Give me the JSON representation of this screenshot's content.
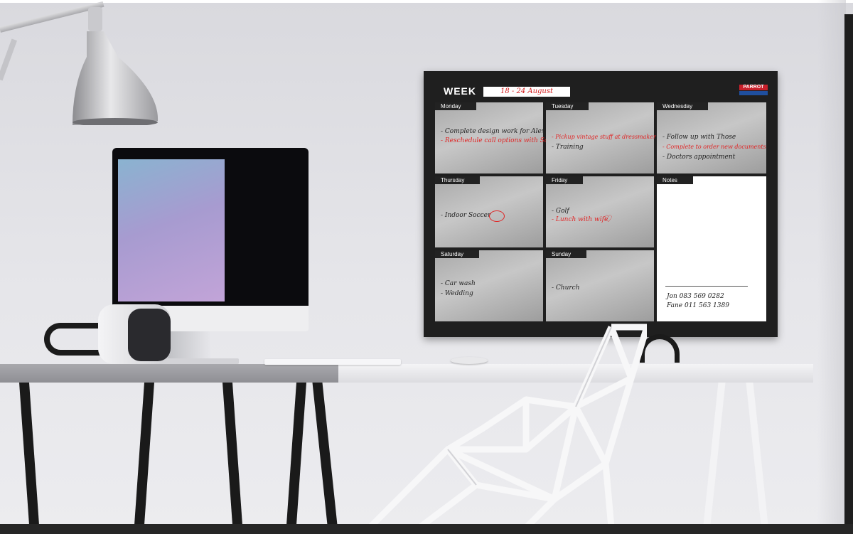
{
  "planner": {
    "week_label": "WEEK",
    "date_range": "18 - 24 August",
    "brand": "PARROT",
    "days": [
      {
        "key": "monday",
        "label": "Monday",
        "tasks": [
          {
            "text": "- Complete design work for Alex",
            "color": "black"
          },
          {
            "text": "- Reschedule call options with Sara",
            "color": "red"
          }
        ]
      },
      {
        "key": "tuesday",
        "label": "Tuesday",
        "tasks": [
          {
            "text": "- Pickup vintage stuff at dressmaker",
            "color": "red"
          },
          {
            "text": "- Training",
            "color": "black"
          }
        ]
      },
      {
        "key": "wednesday",
        "label": "Wednesday",
        "tasks": [
          {
            "text": "- Follow up with Those",
            "color": "black"
          },
          {
            "text": "- Complete to order new documents",
            "color": "red"
          },
          {
            "text": "- Doctors appointment",
            "color": "black"
          }
        ]
      },
      {
        "key": "thursday",
        "label": "Thursday",
        "tasks": [
          {
            "text": "- Indoor Soccer",
            "color": "black"
          }
        ]
      },
      {
        "key": "friday",
        "label": "Friday",
        "tasks": [
          {
            "text": "- Golf",
            "color": "black"
          },
          {
            "text": "- Lunch with wife",
            "color": "red"
          }
        ]
      },
      {
        "key": "saturday",
        "label": "Saturday",
        "tasks": [
          {
            "text": "- Car wash",
            "color": "black"
          },
          {
            "text": "- Wedding",
            "color": "black"
          }
        ]
      },
      {
        "key": "sunday",
        "label": "Sunday",
        "tasks": [
          {
            "text": "- Church",
            "color": "black"
          }
        ]
      }
    ],
    "notes": {
      "label": "Notes",
      "lines": [
        "Jon 083 569 0282",
        "Fane 011 563 1389"
      ]
    }
  },
  "colors": {
    "board": "#1f1f1f",
    "red_marker": "#e02424",
    "wall": "#e2e2e6"
  }
}
